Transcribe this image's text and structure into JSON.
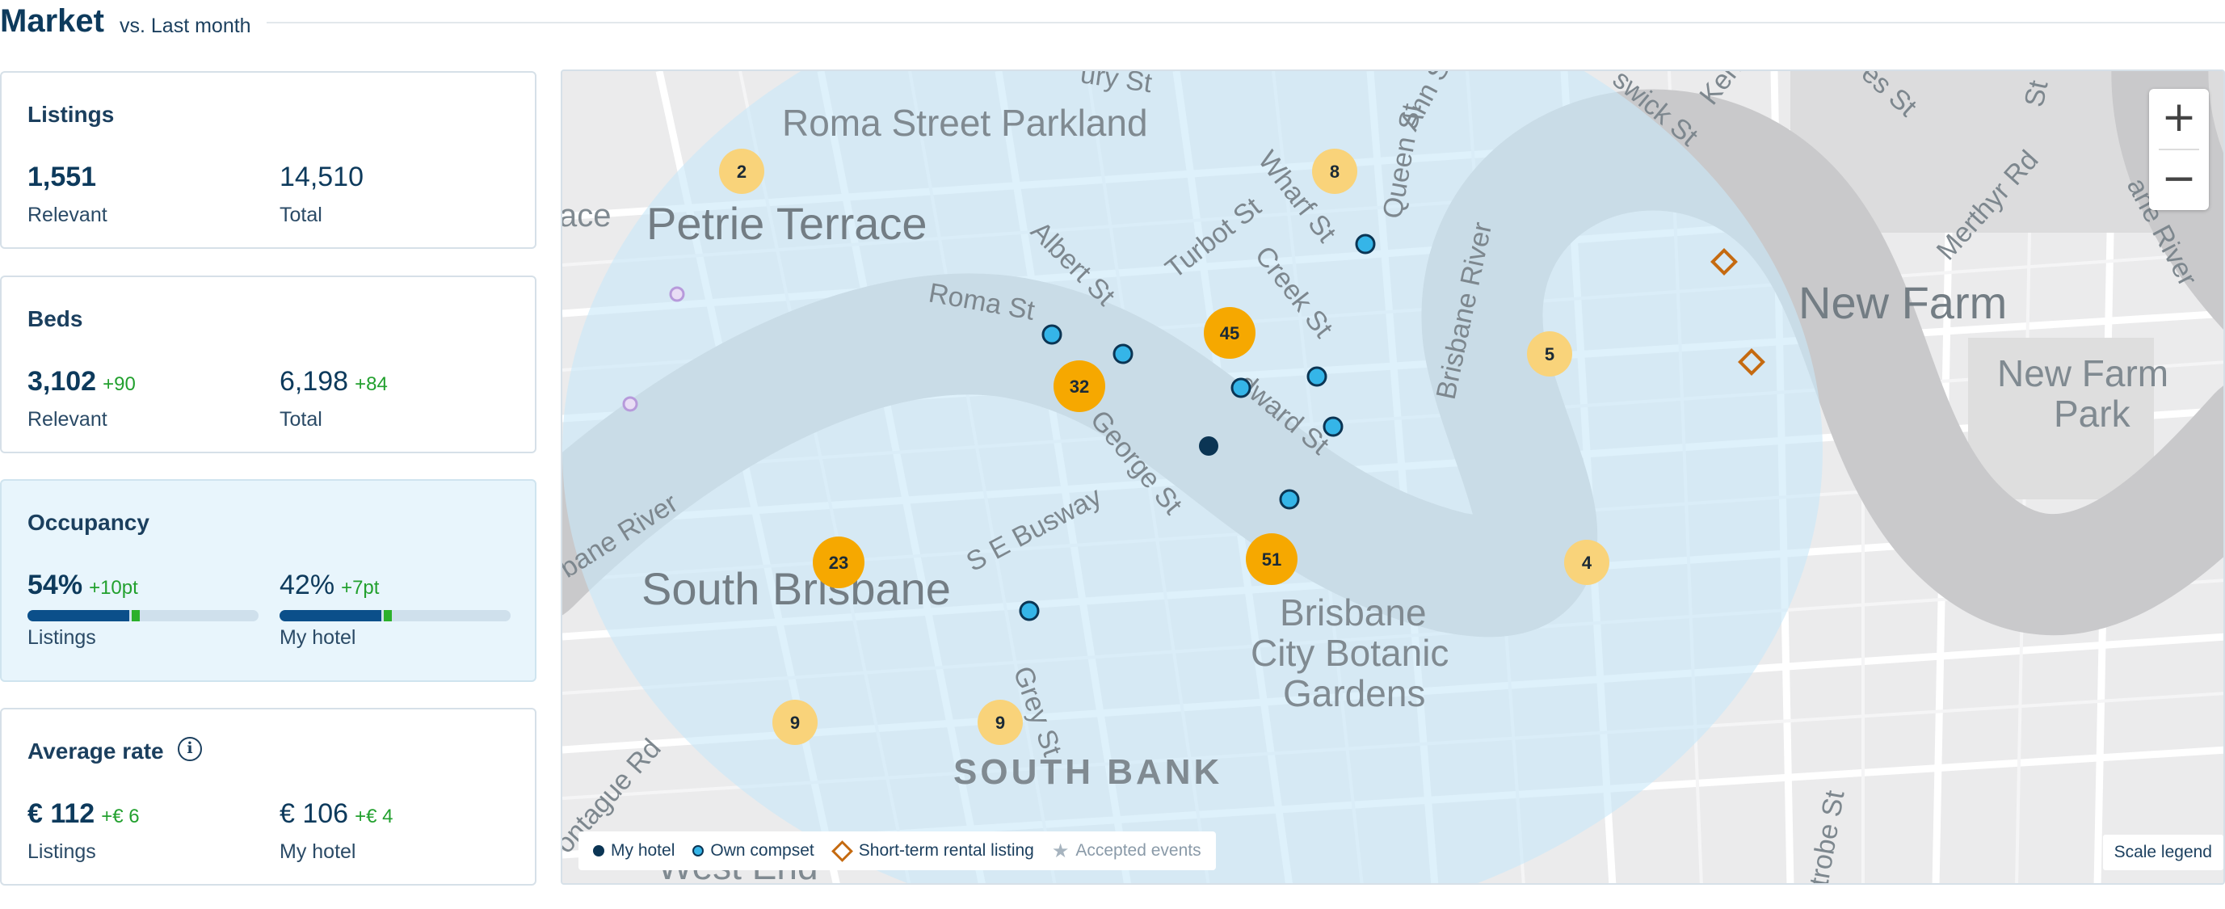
{
  "header": {
    "title": "Market",
    "subtitle": "vs. Last month"
  },
  "cards": {
    "listings": {
      "title": "Listings",
      "left": {
        "value": "1,551",
        "label": "Relevant"
      },
      "right": {
        "value": "14,510",
        "label": "Total"
      }
    },
    "beds": {
      "title": "Beds",
      "left": {
        "value": "3,102",
        "delta": "+90",
        "label": "Relevant"
      },
      "right": {
        "value": "6,198",
        "delta": "+84",
        "label": "Total"
      }
    },
    "occupancy": {
      "title": "Occupancy",
      "left": {
        "value": "54%",
        "delta": "+10pt",
        "label": "Listings",
        "fill_percent": 44,
        "marker_percent": 45
      },
      "right": {
        "value": "42%",
        "delta": "+7pt",
        "label": "My hotel",
        "fill_percent": 44,
        "marker_percent": 45
      }
    },
    "average_rate": {
      "title": "Average rate",
      "info_icon": "info-icon",
      "left": {
        "value": "€ 112",
        "delta": "+€ 6",
        "label": "Listings"
      },
      "right": {
        "value": "€ 106",
        "delta": "+€ 4",
        "label": "My hotel"
      }
    }
  },
  "map": {
    "place_labels": {
      "roma_street_parkland": "Roma Street Parkland",
      "petrie_terrace": "Petrie Terrace",
      "new_farm": "New Farm",
      "new_farm_park_1": "New Farm",
      "new_farm_park_2": "Park",
      "south_brisbane": "South Brisbane",
      "south_bank": "SOUTH BANK",
      "botanic_1": "Brisbane",
      "botanic_2": "City Botanic",
      "botanic_3": "Gardens",
      "west_end": "West End",
      "ace": "ace"
    },
    "street_labels": {
      "roma_st": "Roma St",
      "albert_st": "Albert St",
      "turbot_st": "Turbot St",
      "wharf_st": "Wharf St",
      "queen_st": "Queen St",
      "creek_st": "Creek St",
      "edward_st": "dward St",
      "george_st": "George St",
      "se_busway": "S E Busway",
      "grey_st": "Grey St",
      "brisbane_river_1": "Brisbane River",
      "brisbane_river_2": "bane River",
      "merthyr_rd": "Merthyr Rd",
      "montague_rd": "ontague Rd",
      "ann_st": "Ann St",
      "wick_st": "swick St",
      "ken": "Ken",
      "es_st": "es St",
      "st": "St",
      "ury_st": "ury St",
      "trobe_st": "trobe St",
      "bane_river": "ane River"
    },
    "clusters": [
      "2",
      "8",
      "45",
      "32",
      "5",
      "23",
      "51",
      "4",
      "9",
      "9"
    ],
    "zoom_in": "+",
    "zoom_out": "−",
    "legend": {
      "my_hotel": "My hotel",
      "own_compset": "Own compset",
      "short_term": "Short-term rental listing",
      "accepted_events": "Accepted events"
    },
    "scale_legend": "Scale legend"
  },
  "colors": {
    "brand_dark": "#0d3a5c",
    "positive": "#22a02e",
    "cluster_big": "#f6a800",
    "cluster_small": "#f9d37a",
    "compset": "#35b5e8",
    "short_term": "#c56a10",
    "radius": "#c9e8f8"
  }
}
